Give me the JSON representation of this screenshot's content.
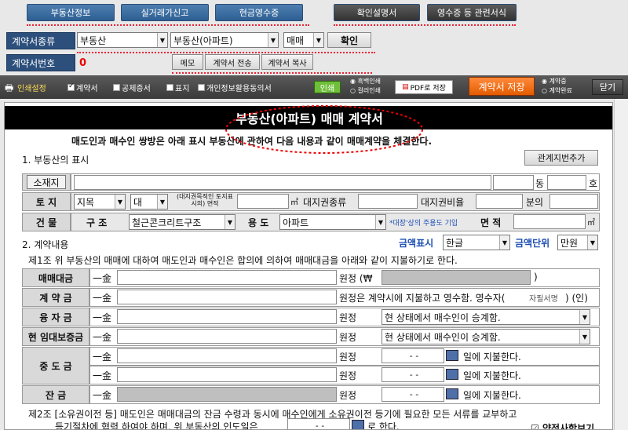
{
  "top_buttons": [
    "부동산정보",
    "실거래가신고",
    "현금영수증",
    "확인설명서",
    "영수증 등 관련서식"
  ],
  "contract": {
    "type_label": "계약서종류",
    "type_value": "부동산",
    "subtype_value": "부동산(아파트)",
    "deal_value": "매매",
    "confirm": "확인",
    "number_label": "계약서번호",
    "number_value": "0",
    "memo": "메모",
    "send": "계약서 전송",
    "copy": "계약서 복사"
  },
  "toolbar": {
    "print_settings": "인쇄설정",
    "opt1": "계약서",
    "opt2": "공제증서",
    "opt3": "표지",
    "opt4": "개인정보활용동의서",
    "print": "인쇄",
    "bw": "흑백인쇄",
    "color": "컬러인쇄",
    "pdf": "PDF로 저장",
    "save": "계약서 저장",
    "r1": "계약중",
    "r2": "계약완료",
    "close": "닫기"
  },
  "doc": {
    "title": "부동산(아파트) 매매 계약서",
    "intro": "매도인과 매수인 쌍방은 아래 표시 부동산에 관하여 다음 내용과 같이 매매계약을 체결한다.",
    "sec1": "1. 부동산의 표시",
    "add_lot": "관계지번추가",
    "loc": "소재지",
    "dong": "동",
    "ho": "호",
    "land": "토 지",
    "land_type": "지목",
    "land_cat": "대",
    "land_area_note": "(대지권목적인 토지표시의) 면적",
    "sqm": "㎡",
    "right_type": "대지권종류",
    "right_ratio": "대지권비율",
    "fraction": "분의",
    "building": "건 물",
    "structure": "구 조",
    "structure_val": "철근콘크리트구조",
    "use": "용 도",
    "use_val": "아파트",
    "use_note": "*대장'상의 주용도 기입",
    "area": "면 적",
    "sec2": "2. 계약내용",
    "amount_display": "금액표시",
    "amount_display_val": "한글",
    "amount_unit": "금액단위",
    "amount_unit_val": "만원",
    "art1": "제1조 위 부동산의 매매에 대하여 매도인과 매수인은 합의에 의하여 매매대금을 아래와 같이 지불하기로 한다.",
    "price": "매매대금",
    "deposit": "계 약 금",
    "loan": "융 자 금",
    "lease_dep": "현 임대보증금",
    "middle": "중 도 금",
    "balance": "잔 금",
    "won": "一金",
    "won_is": "원정",
    "won_symbol": "원정 (₩",
    "close_paren": ")",
    "deposit_text": "원정은 계약시에 지불하고 영수함. 영수자(",
    "sign": "자필서명",
    ") (인)": "",
    "sign_close": ") (인)",
    "succeed": "현 상태에서 매수인이 승계함.",
    "date_ph": "-  -",
    "pay": "일에 지불한다.",
    "art2a": "제2조 [소유권이전 등] 매도인은 매매대금의 잔금 수령과 동시에 매수인에게 소유권이전 등기에 필요한 모든 서류를 교부하고",
    "art2b": "등기절차에 협력 하여야 하며, 위 부동산의 인도일은",
    "art2c": "로 한다.",
    "special": "약정사항보기"
  }
}
